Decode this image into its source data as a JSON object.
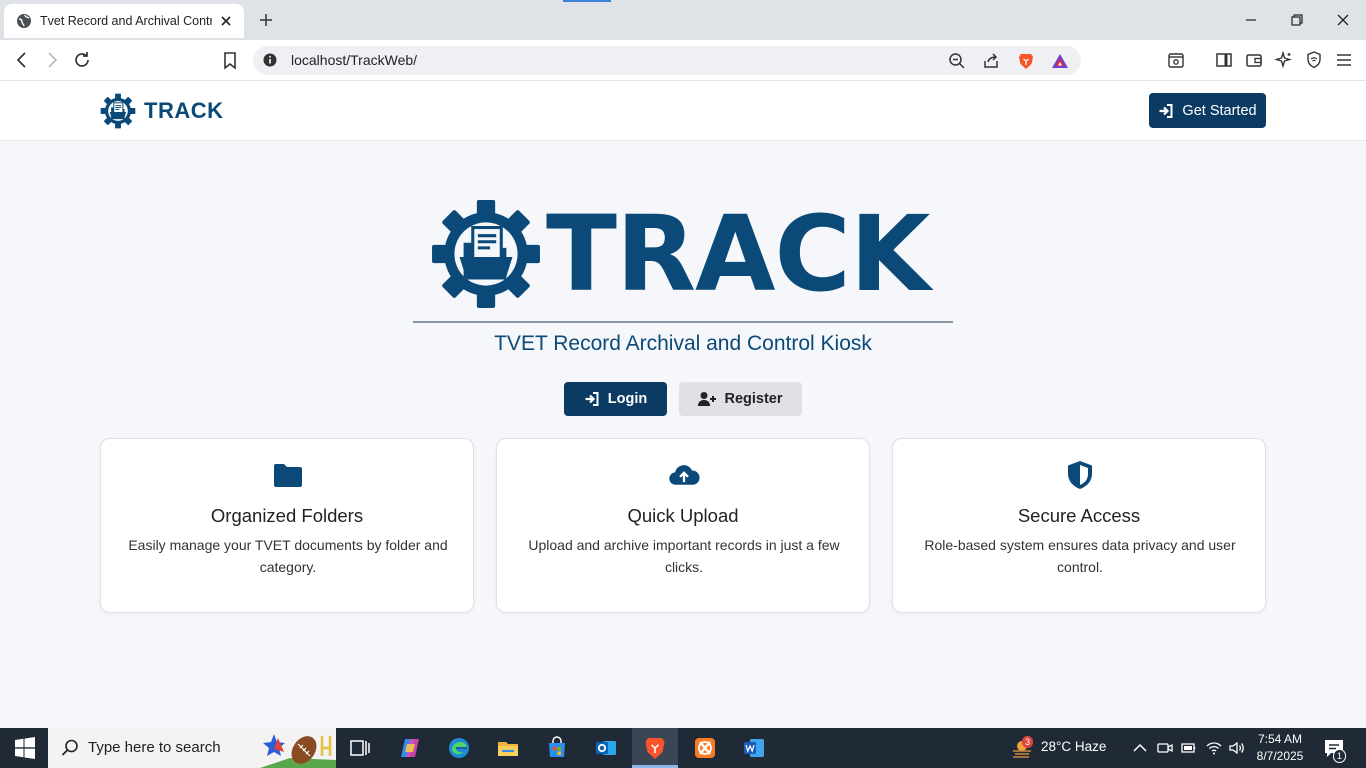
{
  "browser": {
    "tab_title": "Tvet Record and Archival Control Kiosk",
    "url": "localhost/TrackWeb/"
  },
  "nav": {
    "brand": "TRACK",
    "get_started": "Get Started"
  },
  "hero": {
    "logo_word": "TRACK",
    "tagline": "TVET Record Archival and Control Kiosk",
    "login": "Login",
    "register": "Register"
  },
  "features": [
    {
      "title": "Organized Folders",
      "text": "Easily manage your TVET documents by folder and category.",
      "icon": "folder-icon"
    },
    {
      "title": "Quick Upload",
      "text": "Upload and archive important records in just a few clicks.",
      "icon": "cloud-upload-icon"
    },
    {
      "title": "Secure Access",
      "text": "Role-based system ensures data privacy and user control.",
      "icon": "shield-icon"
    }
  ],
  "taskbar": {
    "search_placeholder": "Type here to search",
    "weather": "28°C  Haze",
    "weather_badge": "3",
    "time": "7:54 AM",
    "date": "8/7/2025",
    "notification_count": "1"
  },
  "colors": {
    "brand_primary": "#0b4a78",
    "button_dark": "#0b3a63",
    "page_bg": "#f5f7fa"
  }
}
